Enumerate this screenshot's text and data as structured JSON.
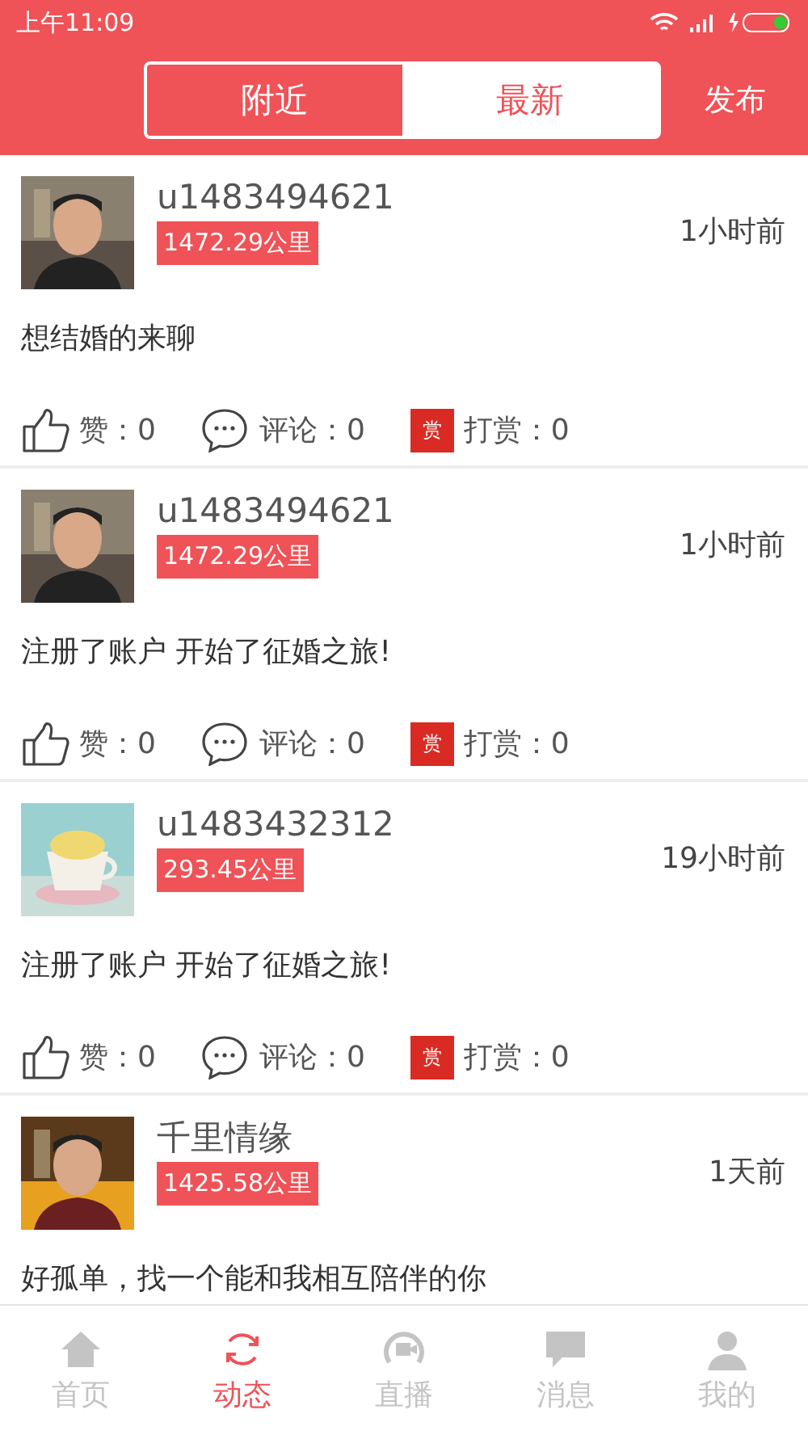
{
  "status_bar": {
    "time": "上午11:09"
  },
  "header": {
    "tabs": [
      {
        "label": "附近",
        "selected": false
      },
      {
        "label": "最新",
        "selected": true
      }
    ],
    "publish": "发布"
  },
  "posts": [
    {
      "username": "u1483494621",
      "distance": "1472.29公里",
      "time": "1小时前",
      "content": "想结婚的来聊",
      "likes": "赞：0",
      "comments": "评论：0",
      "reward_badge": "赏",
      "rewards": "打赏：0"
    },
    {
      "username": "u1483494621",
      "distance": "1472.29公里",
      "time": "1小时前",
      "content": "注册了账户 开始了征婚之旅!",
      "likes": "赞：0",
      "comments": "评论：0",
      "reward_badge": "赏",
      "rewards": "打赏：0"
    },
    {
      "username": "u1483432312",
      "distance": "293.45公里",
      "time": "19小时前",
      "content": "注册了账户 开始了征婚之旅!",
      "likes": "赞：0",
      "comments": "评论：0",
      "reward_badge": "赏",
      "rewards": "打赏：0"
    },
    {
      "username": "千里情缘",
      "distance": "1425.58公里",
      "time": "1天前",
      "content": "好孤单，找一个能和我相互陪伴的你"
    }
  ],
  "bottom_nav": [
    {
      "label": "首页",
      "selected": false
    },
    {
      "label": "动态",
      "selected": true
    },
    {
      "label": "直播",
      "selected": false
    },
    {
      "label": "消息",
      "selected": false
    },
    {
      "label": "我的",
      "selected": false
    }
  ]
}
